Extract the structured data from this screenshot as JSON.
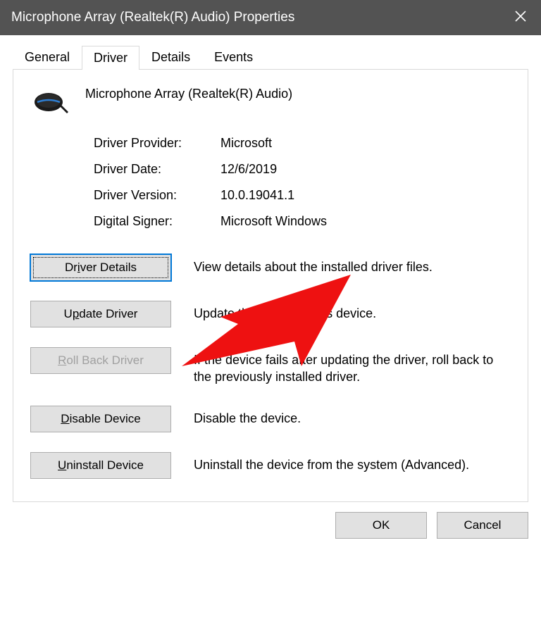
{
  "title": "Microphone Array (Realtek(R) Audio) Properties",
  "tabs": {
    "general": "General",
    "driver": "Driver",
    "details": "Details",
    "events": "Events"
  },
  "device_name": "Microphone Array (Realtek(R) Audio)",
  "info": {
    "provider_label": "Driver Provider:",
    "provider_value": "Microsoft",
    "date_label": "Driver Date:",
    "date_value": "12/6/2019",
    "version_label": "Driver Version:",
    "version_value": "10.0.19041.1",
    "signer_label": "Digital Signer:",
    "signer_value": "Microsoft Windows"
  },
  "actions": {
    "details_btn_pre": "Dr",
    "details_btn_m": "i",
    "details_btn_post": "ver Details",
    "details_desc": "View details about the installed driver files.",
    "update_btn_pre": "U",
    "update_btn_m": "p",
    "update_btn_post": "date Driver",
    "update_desc": "Update the driver for this device.",
    "rollback_btn_pre": "",
    "rollback_btn_m": "R",
    "rollback_btn_post": "oll Back Driver",
    "rollback_desc": "If the device fails after updating the driver, roll back to the previously installed driver.",
    "disable_btn_pre": "",
    "disable_btn_m": "D",
    "disable_btn_post": "isable Device",
    "disable_desc": "Disable the device.",
    "uninstall_btn_pre": "",
    "uninstall_btn_m": "U",
    "uninstall_btn_post": "ninstall Device",
    "uninstall_desc": "Uninstall the device from the system (Advanced)."
  },
  "buttons": {
    "ok": "OK",
    "cancel": "Cancel"
  }
}
